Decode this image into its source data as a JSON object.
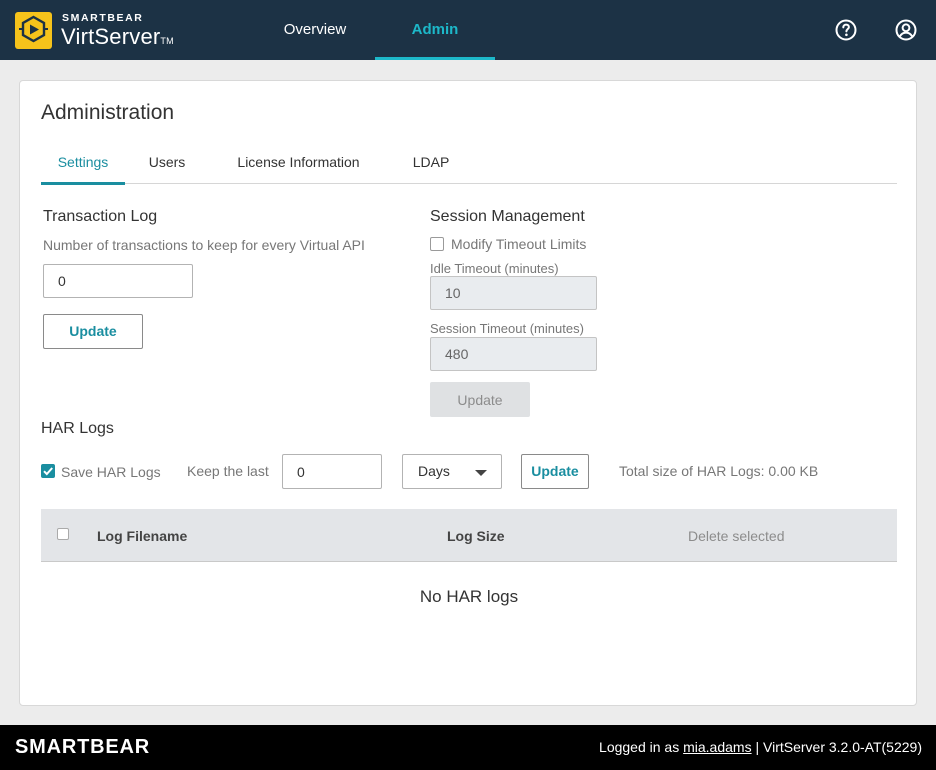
{
  "header": {
    "brand_small": "SMARTBEAR",
    "brand_name": "VirtServer",
    "brand_tm": "TM",
    "nav": [
      {
        "label": "Overview",
        "active": false
      },
      {
        "label": "Admin",
        "active": true
      }
    ],
    "icons": [
      "help-icon",
      "user-icon"
    ]
  },
  "page": {
    "title": "Administration",
    "tabs": [
      {
        "label": "Settings",
        "active": true
      },
      {
        "label": "Users",
        "active": false
      },
      {
        "label": "License Information",
        "active": false
      },
      {
        "label": "LDAP",
        "active": false
      }
    ]
  },
  "transaction_log": {
    "title": "Transaction Log",
    "helper": "Number of transactions to keep for every Virtual API",
    "value": "0",
    "update_label": "Update"
  },
  "session_management": {
    "title": "Session Management",
    "modify_label": "Modify Timeout Limits",
    "modify_checked": false,
    "idle_label": "Idle Timeout (minutes)",
    "idle_value": "10",
    "session_label": "Session Timeout (minutes)",
    "session_value": "480",
    "update_label": "Update"
  },
  "har_logs": {
    "title": "HAR Logs",
    "save_label": "Save HAR Logs",
    "save_checked": true,
    "keep_label": "Keep the last",
    "keep_value": "0",
    "unit": "Days",
    "update_label": "Update",
    "total_size": "Total size of HAR Logs: 0.00 KB",
    "table": {
      "columns": [
        "Log Filename",
        "Log Size"
      ],
      "delete_label": "Delete selected",
      "empty_message": "No HAR logs"
    }
  },
  "footer": {
    "brand": "SMARTBEAR",
    "logged_in_prefix": "Logged in as",
    "username": "mia.adams",
    "separator": "|",
    "version": "VirtServer 3.2.0-AT(5229)"
  },
  "colors": {
    "header_bg": "#1c3245",
    "accent": "#1db8c9",
    "teal": "#1a8ea0",
    "logo_yellow": "#f6c31b"
  }
}
